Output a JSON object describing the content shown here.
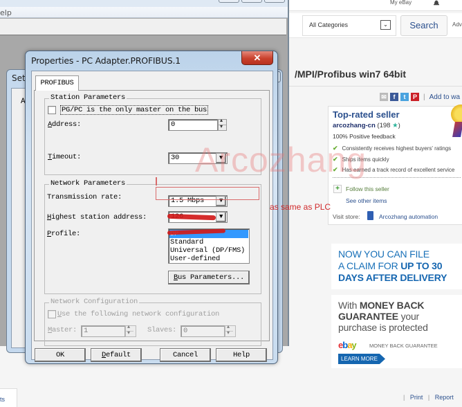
{
  "ebay": {
    "my_ebay": "My eBay",
    "category_select": "All Categories",
    "search_button": "Search",
    "advanced_link": "Adv",
    "item_title": "/MPI/Profibus win7 64bit",
    "add_to_watchlist": "Add to wa",
    "seller": {
      "badge": "Top-rated seller",
      "name": "arcozhang-cn",
      "feedback_count": "198",
      "positive_feedback": "100% Positive feedback",
      "checks": [
        "Consistently receives highest buyers' ratings",
        "Ships items quickly",
        "Has earned a track record of excellent service"
      ],
      "follow": "Follow this seller",
      "see_other_items": "See other items",
      "visit_store_label": "Visit store:",
      "store_name": "Arcozhang automation"
    },
    "promo_claim": {
      "line1": "NOW YOU CAN FILE",
      "line2_normal": "A CLAIM FOR ",
      "line2_bold": "UP TO 30",
      "line3": "DAYS AFTER  DELIVERY"
    },
    "promo_mbg": {
      "line1_normal": "With ",
      "line1_bold": "MONEY BACK",
      "line2_bold": "GUARANTEE",
      "line2_normal": " your",
      "line3": "purchase is protected",
      "logo_letters": [
        "e",
        "b",
        "a",
        "y"
      ],
      "mbg_label": "MONEY BACK GUARANTEE",
      "learn_more": "LEARN MORE"
    },
    "footer_links": [
      "Print",
      "Report"
    ],
    "left_tab_text": "ts"
  },
  "app": {
    "menu_help": "elp"
  },
  "back_dialog": {
    "title": "Set",
    "close": "✕",
    "label_fragment": "A"
  },
  "dialog": {
    "title": "Properties - PC Adapter.PROFIBUS.1",
    "close": "✕",
    "tab": "PROFIBUS",
    "station": {
      "caption": "Station Parameters",
      "only_master_label": "PG/PC is the only master on the bus",
      "only_master_checked": false,
      "address_label": "Address:",
      "address_value": "0",
      "timeout_label": "Timeout:",
      "timeout_value": "30"
    },
    "network": {
      "caption": "Network Parameters",
      "rate_label": "Transmission rate:",
      "rate_value": "1.5 Mbps",
      "hsa_label": "Highest station address:",
      "hsa_value": "126",
      "profile_label": "Profile:",
      "profiles": [
        "DP",
        "Standard",
        "Universal (DP/FMS)",
        "User-defined"
      ],
      "profile_selected": "DP",
      "bus_params_button": "Bus Parameters..."
    },
    "netconfig": {
      "caption": "Network Configuration",
      "use_label": "Use the following network configuration",
      "master_label": "Master:",
      "master_value": "1",
      "slaves_label": "Slaves:",
      "slaves_value": "0"
    },
    "buttons": {
      "ok": "OK",
      "default": "Default",
      "cancel": "Cancel",
      "help": "Help"
    }
  },
  "annotations": {
    "watermark": "Arcozhang",
    "note": "as same as PLC"
  },
  "colors": {
    "ebay_link": "#2a4f8d",
    "selection": "#3399ff",
    "annotation_red": "#d0282a",
    "close_red": "#c9412d"
  }
}
